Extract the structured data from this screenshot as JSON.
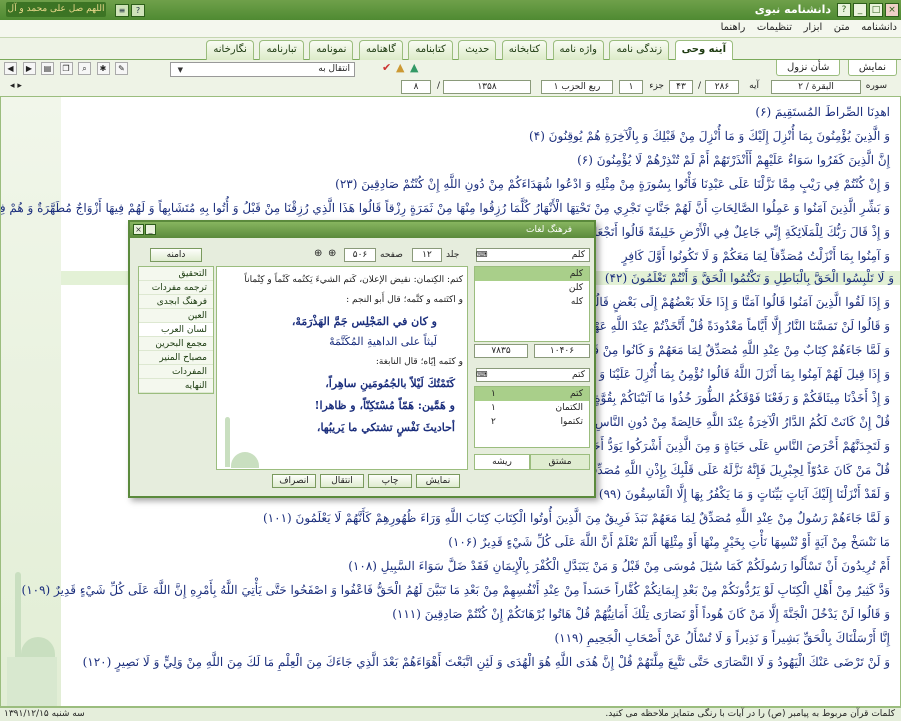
{
  "window": {
    "title": "دانشنامه نبوی",
    "calligraphy": "اللهم صل علی محمد و آل محمد"
  },
  "menu": [
    "دانشنامه",
    "متن",
    "ابزار",
    "تنظیمات",
    "راهنما"
  ],
  "tabs": [
    {
      "label": "آینه وحی",
      "active": true
    },
    {
      "label": "زندگی نامه"
    },
    {
      "label": "واژه نامه"
    },
    {
      "label": "کتابخانه"
    },
    {
      "label": "حدیث"
    },
    {
      "label": "کتابنامه"
    },
    {
      "label": "گاهنامه"
    },
    {
      "label": "نمونامه"
    },
    {
      "label": "تبارنامه"
    },
    {
      "label": "نگارخانه"
    }
  ],
  "subtabs": [
    "نمایش",
    "شأن نزول"
  ],
  "navigation": {
    "select_label": "انتقال به"
  },
  "location": {
    "sura_label": "سوره",
    "sura_value": "۲ / البقرة",
    "aya_label": "آیه",
    "aya_value": "۲۸۶",
    "aya_sep": "/",
    "aya_current": "۴۳",
    "juz_label": "جزء",
    "juz_value": "۱",
    "hizb_value": "ربع الحزب ۱",
    "page_value": "۱۳۵۸",
    "page_sep": "/",
    "page_current": "۸"
  },
  "verses": [
    "اهدِنَا الصِّراطَ المُستَقِيمَ (۶)",
    "وَ الَّذِينَ يُؤْمِنُونَ بِمَا أُنْزِلَ إِلَيْكَ وَ مَا أُنْزِلَ مِنْ قَبْلِكَ وَ بِالْآخِرَةِ هُمْ يُوقِنُونَ (۴)",
    "إِنَّ الَّذِينَ كَفَرُوا سَوَاءٌ عَلَيْهِمْ أَأَنْذَرْتَهُمْ أَمْ لَمْ تُنْذِرْهُمْ لَا يُؤْمِنُونَ (۶)",
    "وَ إِنْ كُنْتُمْ فِي رَيْبٍ مِمَّا نَزَّلْنَا عَلَى عَبْدِنَا فَأْتُوا بِسُورَةٍ مِنْ مِثْلِهِ وَ ادْعُوا شُهَدَاءَكُمْ مِنْ دُونِ اللَّهِ إِنْ كُنْتُمْ صَادِقِينَ (۲۳)",
    "وَ بَشِّرِ الَّذِينَ آمَنُوا وَ عَمِلُوا الصَّالِحَاتِ أَنَّ لَهُمْ جَنَّاتٍ تَجْرِي مِنْ تَحْتِهَا الْأَنْهَارُ كُلَّمَا رُزِقُوا مِنْهَا مِنْ ثَمَرَةٍ رِزْقاً قَالُوا هَذَا الَّذِي رُزِقْنَا مِنْ قَبْلُ وَ أُتُوا بِهِ مُتَشَابِهاً وَ لَهُمْ فِيهَا أَزْوَاجٌ مُطَهَّرَةٌ وَ هُمْ فِيهَا خَالِدُونَ (۲۵)",
    "وَ إِذْ قَالَ رَبُّكَ لِلْمَلَائِكَةِ إِنِّي جَاعِلٌ فِي الْأَرْضِ خَلِيفَةً قَالُوا أَتَجْعَلُ",
    "وَ آمِنُوا بِمَا أَنْزَلْتُ مُصَدِّقاً لِمَا مَعَكُمْ وَ لَا تَكُونُوا أَوَّلَ كَافِرٍ",
    "وَ لَا تَلْبِسُوا الْحَقَّ بِالْبَاطِلِ وَ تَكْتُمُوا الْحَقَّ وَ أَنْتُمْ تَعْلَمُونَ (۴۲)",
    "وَ إِذَا لَقُوا الَّذِينَ آمَنُوا قَالُوا آمَنَّا وَ إِذَا خَلَا بَعْضُهُمْ إِلَى بَعْضٍ قَالُوا",
    "وَ قَالُوا لَنْ تَمَسَّنَا النَّارُ إِلَّا أَيَّاماً مَعْدُودَةً قُلْ أَتَّخَذْتُمْ عِنْدَ اللَّهِ عَهْداً",
    "وَ لَمَّا جَاءَهُمْ كِتَابٌ مِنْ عِنْدِ اللَّهِ مُصَدِّقٌ لِمَا مَعَهُمْ وَ كَانُوا مِنْ قَبْلُ يَسْتَفْتِحُونَ",
    "وَ إِذَا قِيلَ لَهُمْ آمِنُوا بِمَا أَنْزَلَ اللَّهُ قَالُوا نُؤْمِنُ بِمَا أُنْزِلَ عَلَيْنَا وَ يَكْفُرُونَ",
    "وَ إِذْ أَخَذْنَا مِيثَاقَكُمْ وَ رَفَعْنَا فَوْقَكُمُ الطُّورَ خُذُوا مَا آتَيْنَاكُمْ بِقُوَّةٍ وَ اسْمَعُوا",
    "قُلْ إِنْ كَانَتْ لَكُمُ الدَّارُ الْآخِرَةُ عِنْدَ اللَّهِ خَالِصَةً مِنْ دُونِ النَّاسِ فَتَمَنَّوُا",
    "وَ لَتَجِدَنَّهُمْ أَحْرَصَ النَّاسِ عَلَى حَيَاةٍ وَ مِنَ الَّذِينَ أَشْرَكُوا يَوَدُّ أَحَدُهُمْ",
    "قُلْ مَنْ كَانَ عَدُوّاً لِجِبْرِيلَ فَإِنَّهُ نَزَّلَهُ عَلَى قَلْبِكَ بِإِذْنِ اللَّهِ مُصَدِّقاً",
    "وَ لَقَدْ أَنْزَلْنَا إِلَيْكَ آيَاتٍ بَيِّنَاتٍ وَ مَا يَكْفُرُ بِهَا إِلَّا الْفَاسِقُونَ (۹۹)",
    "وَ لَمَّا جَاءَهُمْ رَسُولٌ مِنْ عِنْدِ اللَّهِ مُصَدِّقٌ لِمَا مَعَهُمْ نَبَذَ فَرِيقٌ مِنَ الَّذِينَ أُوتُوا الْكِتَابَ كِتَابَ اللَّهِ وَرَاءَ ظُهُورِهِمْ كَأَنَّهُمْ لَا يَعْلَمُونَ (۱۰۱)",
    "مَا نَنْسَخْ مِنْ آيَةٍ أَوْ نُنْسِهَا نَأْتِ بِخَيْرٍ مِنْهَا أَوْ مِثْلِهَا أَلَمْ تَعْلَمْ أَنَّ اللَّهَ عَلَى كُلِّ شَيْءٍ قَدِيرٌ (۱۰۶)",
    "أَمْ تُرِيدُونَ أَنْ تَسْأَلُوا رَسُولَكُمْ كَمَا سُئِلَ مُوسَى مِنْ قَبْلُ وَ مَنْ يَتَبَدَّلِ الْكُفْرَ بِالْإِيمَانِ فَقَدْ ضَلَّ سَوَاءَ السَّبِيلِ (۱۰۸)",
    "وَدَّ كَثِيرٌ مِنْ أَهْلِ الْكِتَابِ لَوْ يَرُدُّونَكُمْ مِنْ بَعْدِ إِيمَانِكُمْ كُفَّاراً حَسَداً مِنْ عِنْدِ أَنْفُسِهِمْ مِنْ بَعْدِ مَا تَبَيَّنَ لَهُمُ الْحَقُّ فَاعْفُوا وَ اصْفَحُوا حَتَّى يَأْتِيَ اللَّهُ بِأَمْرِهِ إِنَّ اللَّهَ عَلَى كُلِّ شَيْءٍ قَدِيرٌ (۱۰۹)",
    "وَ قَالُوا لَنْ يَدْخُلَ الْجَنَّةَ إِلَّا مَنْ كَانَ هُوداً أَوْ نَصَارَى تِلْكَ أَمَانِيُّهُمْ قُلْ هَاتُوا بُرْهَانَكُمْ إِنْ كُنْتُمْ صَادِقِينَ (۱۱۱)",
    "إِنَّا أَرْسَلْنَاكَ بِالْحَقِّ بَشِيراً وَ نَذِيراً وَ لَا تُسْأَلُ عَنْ أَصْحَابِ الْجَحِيمِ (۱۱۹)",
    "وَ لَنْ تَرْضَى عَنْكَ الْيَهُودُ وَ لَا النَّصَارَى حَتَّى تَتَّبِعَ مِلَّتَهُمْ قُلْ إِنَّ هُدَى اللَّهِ هُوَ الْهُدَى وَ لَئِنِ اتَّبَعْتَ أَهْوَاءَهُمْ بَعْدَ الَّذِي جَاءَكَ مِنَ الْعِلْمِ مَا لَكَ مِنَ اللَّهِ مِنْ وَلِيٍّ وَ لَا نَصِيرٍ (۱۲۰)"
  ],
  "status": {
    "note": "کلمات قرآن مربوط به پیامبر (ص) را در آیات با رنگی متمایز ملاحظه می کنید.",
    "date": "سه شنبه ۱۳۹۱/۱۲/۱۵"
  },
  "dialog": {
    "title": "فرهنگ لغات",
    "search_label": "کلم",
    "word_list": [
      "کلم",
      "کلن",
      "کله"
    ],
    "counter_left": "۱۰۴۰۶",
    "counter_right": "۷۸۳۵",
    "search2_label": "کتم",
    "results": [
      {
        "word": "کتم",
        "count": "۱",
        "selected": true
      },
      {
        "word": "الکتمان",
        "count": "۱"
      },
      {
        "word": "تکتموا",
        "count": "۲"
      }
    ],
    "bottom_tabs": [
      "ریشه",
      "مشتق"
    ],
    "volume_label": "جلد",
    "volume_value": "۱۲",
    "page_label": "صفحه",
    "page_value": "۵۰۶",
    "dictionary_label": "دامنه",
    "libraries": [
      "التحقیق",
      "ترجمه مفردات",
      "فرهنگ ابجدی",
      "العین",
      "لسان العرب",
      "مجمع البحرین",
      "مصباح المنیر",
      "المفردات",
      "النهایه"
    ],
    "active_library": "لسان العرب",
    "gloss": {
      "l1": "کتم: الکِتمان: نقیض الإعلان، کَتم الشيءَ یَکتُمه کَتْماً و کِتْماناً",
      "l2": "و اکتَتمه و کتَّمه؛ قال أَبو النجم :",
      "poem1": "و كان في المَجْلِس جَمَّ الهَذْرَمَهْ،",
      "poem2": "لَيثاً على الداهيةِ المُكَتَّمَهْ",
      "l3": "و کتَمه إیّاه؛ قال النابغة:",
      "poem3": "كَتَمْتُكَ لَيْلاً بالجُمُومَينِ ساهِراً،",
      "poem4": "و هَمَّين: هَمّاً مُسْتَكِنّاً، و ظاهرا!",
      "poem5": "أحاديثَ نَفْسٍ تشتكي ما يَريبُها،"
    },
    "buttons": [
      "نمایش",
      "چاپ",
      "انتقال",
      "انصراف"
    ]
  }
}
